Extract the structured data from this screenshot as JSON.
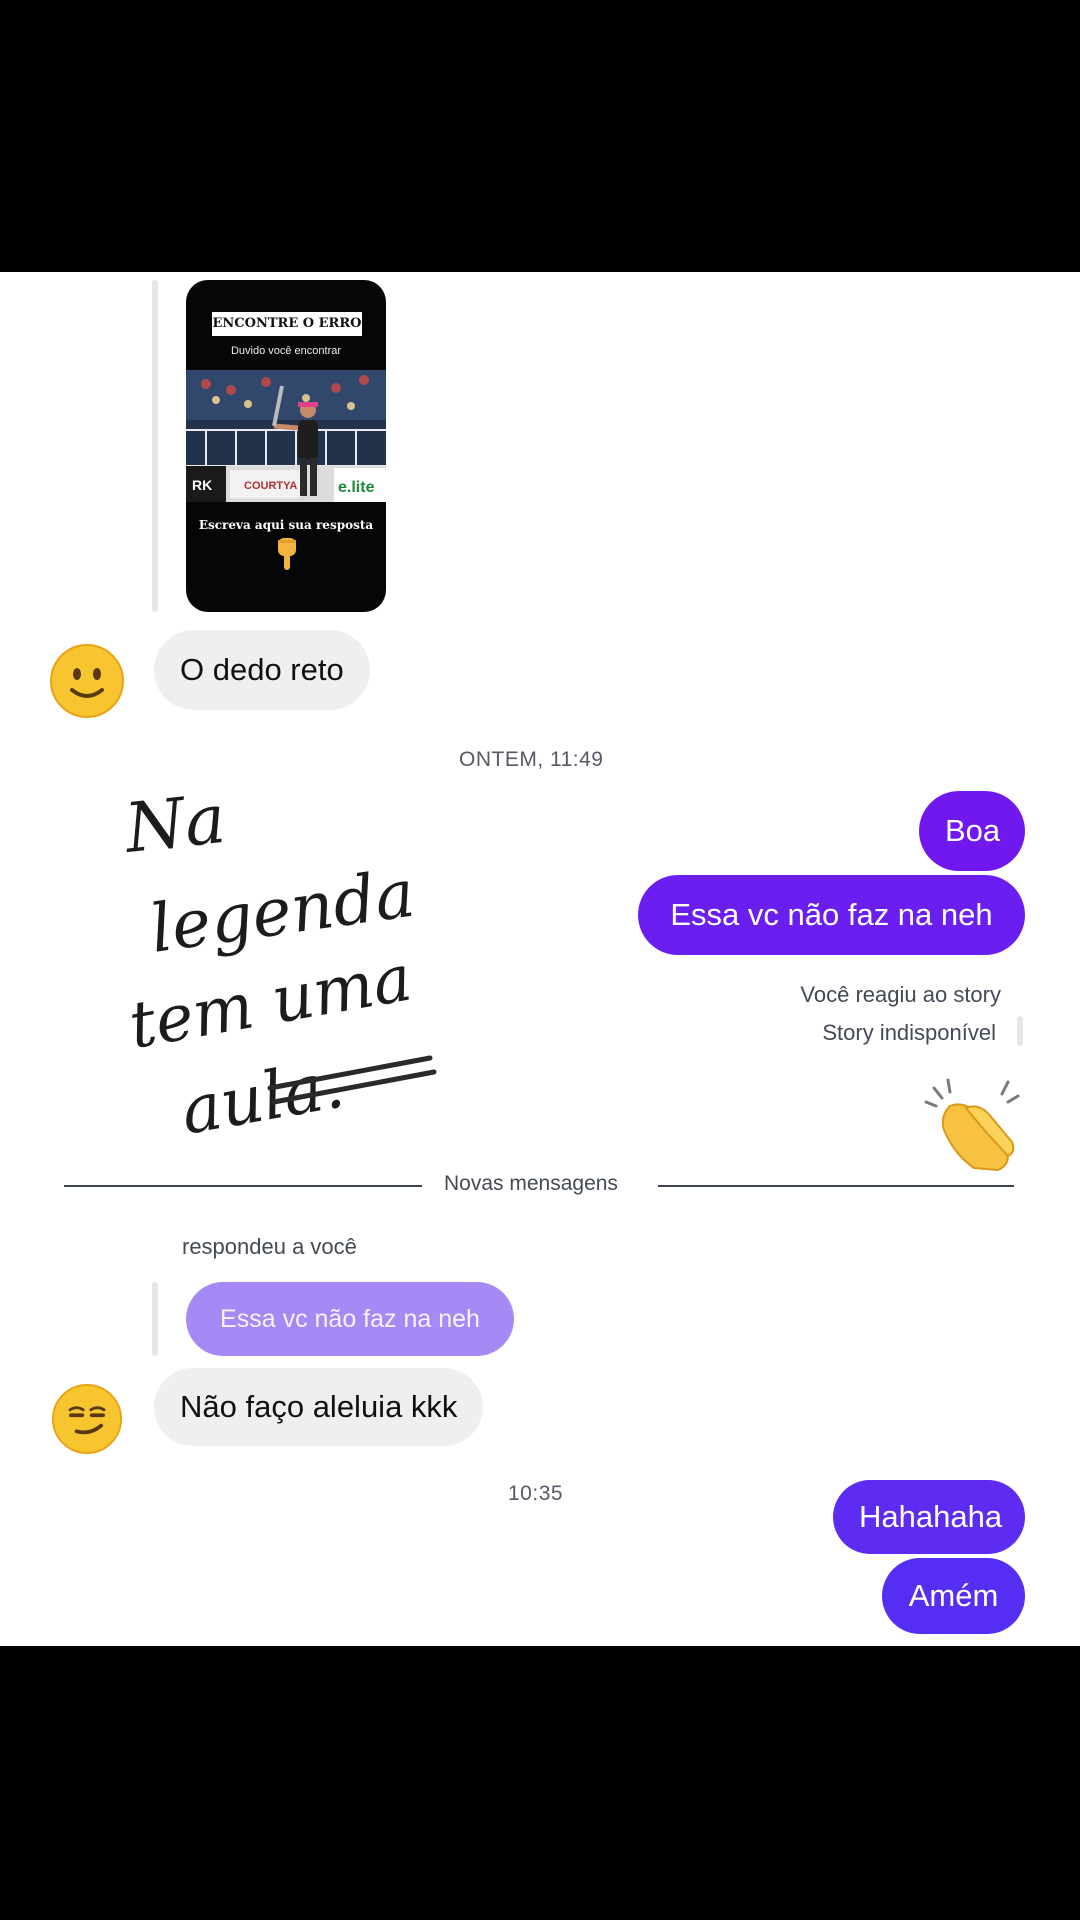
{
  "story": {
    "title": "ENCONTRE O ERRO",
    "subtitle": "Duvido você encontrar",
    "cta": "Escreva aqui sua resposta",
    "sponsors": [
      "RK",
      "COURTYA",
      "e.lite"
    ]
  },
  "messages": {
    "m1": "O dedo reto",
    "timestamp_1": "ONTEM, 11:49",
    "m2": "Boa",
    "m3": "Essa vc não faz na neh",
    "reaction_note": "Você reagiu ao story",
    "story_unavailable": "Story indisponível",
    "divider": "Novas mensagens",
    "replied_to_you": "respondeu a você",
    "quoted": "Essa vc não faz na neh",
    "m4": "Não faço aleluia kkk",
    "timestamp_2": "10:35",
    "m5": "Hahahaha",
    "m6": "Amém"
  },
  "overlay": {
    "handwritten": [
      "Na",
      "legenda",
      "tem uma",
      "aula."
    ]
  },
  "emoji": {
    "avatar_1": "slightly-smiling-face",
    "avatar_2": "smirking-face",
    "reaction": "clapping-hands"
  },
  "colors": {
    "outgoing_purple": "#6a1ff0",
    "outgoing_indigo": "#5a2cf2",
    "incoming_gray": "#efeff2",
    "quoted_lavender": "#a58af5"
  }
}
